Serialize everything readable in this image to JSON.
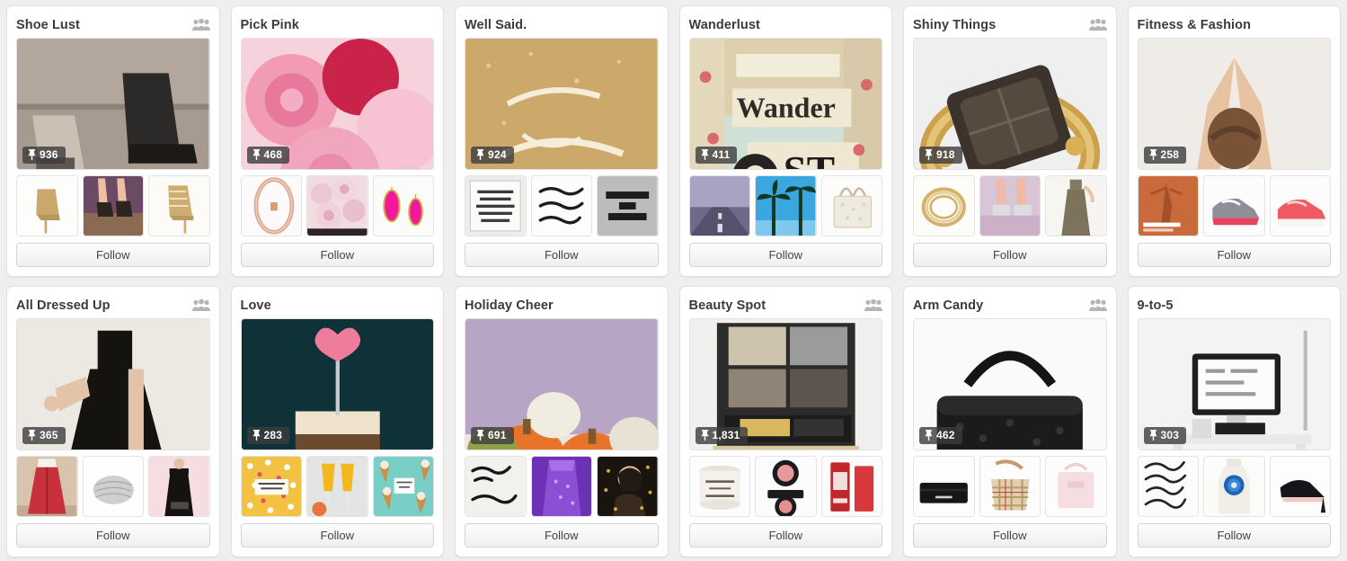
{
  "theme": {
    "page_background": "#efefef",
    "card_background": "#ffffff",
    "title_color": "#3b3b3b",
    "badge_background": "rgba(60,60,60,0.80)",
    "badge_text_color": "#ffffff",
    "follow_text_color": "#444444"
  },
  "labels": {
    "follow": "Follow",
    "pin_icon": "pushpin-icon",
    "collaborator_icon": "collaborators-icon"
  },
  "boards": [
    {
      "title": "Shoe Lust",
      "pin_count": "936",
      "collaborators": true,
      "follow_label": "Follow",
      "cover_alt": "ankle-boots-on-pavement",
      "thumbs": [
        "gold-woven-bootie",
        "strappy-heeled-sandals",
        "gold-caged-heel"
      ]
    },
    {
      "title": "Pick Pink",
      "pin_count": "468",
      "collaborators": false,
      "follow_label": "Follow",
      "cover_alt": "pink-rose-bouquet",
      "thumbs": [
        "rose-gold-bangle",
        "pale-pink-roses",
        "pink-teardrop-earrings"
      ]
    },
    {
      "title": "Well Said.",
      "pin_count": "924",
      "collaborators": false,
      "follow_label": "Follow",
      "cover_alt": "take-chances-gold-glitter-quote",
      "thumbs": [
        "life-is-what-happens-quote",
        "positive-mind-quote",
        "you-are-my-favorite-quote"
      ]
    },
    {
      "title": "Wanderlust",
      "pin_count": "411",
      "collaborators": false,
      "follow_label": "Follow",
      "cover_alt": "not-all-who-wander-are-lost-map-art",
      "thumbs": [
        "open-road-at-dusk",
        "palm-trees-blue-sky",
        "white-monogram-tote"
      ]
    },
    {
      "title": "Shiny Things",
      "pin_count": "918",
      "collaborators": true,
      "follow_label": "Follow",
      "cover_alt": "gold-ring-with-smoky-stone",
      "thumbs": [
        "gold-coiled-bracelet",
        "silver-metallic-sandals",
        "bronze-maxi-dress"
      ]
    },
    {
      "title": "Fitness & Fashion",
      "pin_count": "258",
      "collaborators": false,
      "follow_label": "Follow",
      "cover_alt": "yoga-pose-from-behind",
      "thumbs": [
        "life-hacks-for-living-well",
        "grey-pink-running-shoe",
        "coral-running-shoe"
      ]
    },
    {
      "title": "All Dressed Up",
      "pin_count": "365",
      "collaborators": true,
      "follow_label": "Follow",
      "cover_alt": "black-skater-dress",
      "thumbs": [
        "red-maxi-skirt",
        "silver-beaded-clutch",
        "black-strapless-gown"
      ]
    },
    {
      "title": "Love",
      "pin_count": "283",
      "collaborators": false,
      "follow_label": "Follow",
      "cover_alt": "naked-layer-cake-with-heart-topper",
      "thumbs": [
        "floral-love-card",
        "two-mimosa-glasses",
        "ice-cream-cones-flatlay"
      ]
    },
    {
      "title": "Holiday Cheer",
      "pin_count": "691",
      "collaborators": false,
      "follow_label": "Follow",
      "cover_alt": "decorated-pumpkin-place-settings",
      "thumbs": [
        "excited-much-happy-2015",
        "purple-party-dress",
        "woman-blowing-confetti"
      ]
    },
    {
      "title": "Beauty Spot",
      "pin_count": "1,831",
      "collaborators": true,
      "follow_label": "Follow",
      "cover_alt": "neutral-eyeshadow-palette",
      "thumbs": [
        "the-lip-scrub-confetti-cake",
        "blush-compacts",
        "sugar-coral-lip-treatment"
      ]
    },
    {
      "title": "Arm Candy",
      "pin_count": "462",
      "collaborators": true,
      "follow_label": "Follow",
      "cover_alt": "black-pebbled-leather-satchel",
      "thumbs": [
        "black-kate-spade-wallet",
        "plaid-hobo-bag",
        "blush-pink-tote"
      ]
    },
    {
      "title": "9-to-5",
      "pin_count": "303",
      "collaborators": false,
      "follow_label": "Follow",
      "cover_alt": "white-desk-with-imac",
      "thumbs": [
        "hand-lettered-quote",
        "loccitane-bottle",
        "black-pointed-pump"
      ]
    }
  ]
}
